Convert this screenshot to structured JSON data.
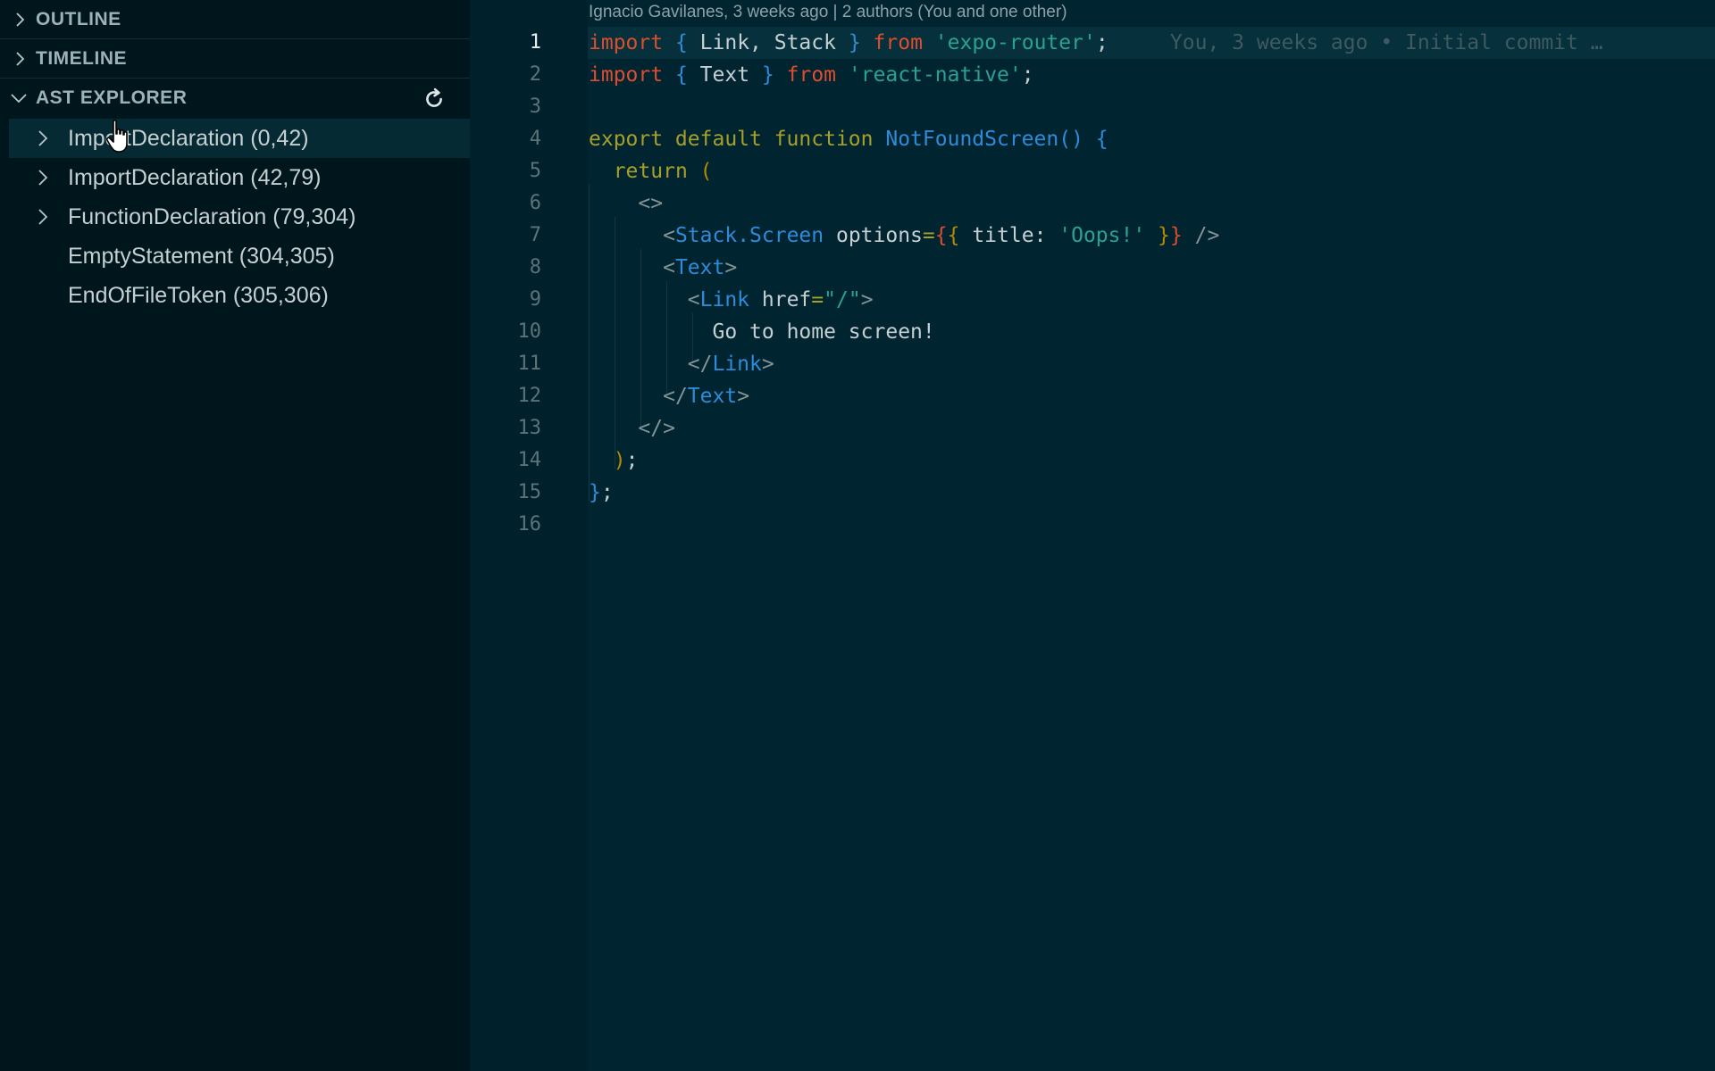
{
  "sidebar": {
    "sections": {
      "outline": "OUTLINE",
      "timeline": "TIMELINE",
      "ast_explorer": "AST EXPLORER"
    },
    "tree": [
      {
        "label": "ImportDeclaration (0,42)"
      },
      {
        "label": "ImportDeclaration (42,79)"
      },
      {
        "label": "FunctionDeclaration (79,304)"
      },
      {
        "label": "EmptyStatement (304,305)"
      },
      {
        "label": "EndOfFileToken (305,306)"
      }
    ]
  },
  "editor": {
    "codelens": "Ignacio Gavilanes, 3 weeks ago | 2 authors (You and one other)",
    "blame": "You, 3 weeks ago • Initial commit …",
    "line_numbers": [
      "1",
      "2",
      "3",
      "4",
      "5",
      "6",
      "7",
      "8",
      "9",
      "10",
      "11",
      "12",
      "13",
      "14",
      "15",
      "16"
    ],
    "code": {
      "l1": {
        "kw_import": "import",
        "open": "{",
        "names": " Link, Stack ",
        "close": "}",
        "kw_from": "from",
        "str": "'expo-router'",
        "semi": ";"
      },
      "l2": {
        "kw_import": "import",
        "open": "{",
        "names": " Text ",
        "close": "}",
        "kw_from": "from",
        "str": "'react-native'",
        "semi": ";"
      },
      "l4": {
        "kw_export": "export default function",
        "fn": "NotFoundScreen",
        "parens": "()",
        "brace": "{"
      },
      "l5": {
        "kw_return": "return",
        "paren": "("
      },
      "l6": {
        "frag": "<>"
      },
      "l7": {
        "lt": "<",
        "tag": "Stack.Screen",
        "attr": " options",
        "eq": "=",
        "ob": "{",
        "ob2": "{",
        "key": " title: ",
        "val": "'Oops!'",
        "cb": " }",
        "cb2": "}",
        "end": " />"
      },
      "l8": {
        "lt": "<",
        "tag": "Text",
        "gt": ">"
      },
      "l9": {
        "lt": "<",
        "tag": "Link",
        "attr": " href",
        "eq": "=",
        "val": "\"/\"",
        "gt": ">"
      },
      "l10": {
        "text": "Go to home screen!"
      },
      "l11": {
        "lt": "</",
        "tag": "Link",
        "gt": ">"
      },
      "l12": {
        "lt": "</",
        "tag": "Text",
        "gt": ">"
      },
      "l13": {
        "frag": "</>"
      },
      "l14": {
        "paren": ")",
        "semi": ";"
      },
      "l15": {
        "brace": "}",
        "semi": ";"
      }
    }
  },
  "colors": {
    "sidebar_bg": "#00161d",
    "editor_bg": "#002430",
    "keyword_red": "#dc4e2f",
    "keyword_olive": "#a6a02a",
    "identifier_blue": "#2f8bd8",
    "string_teal": "#2aa198"
  },
  "icons": {
    "refresh": "refresh-icon",
    "chevron_right": "chevron-right-icon",
    "chevron_down": "chevron-down-icon",
    "cursor": "hand-pointer-icon"
  }
}
